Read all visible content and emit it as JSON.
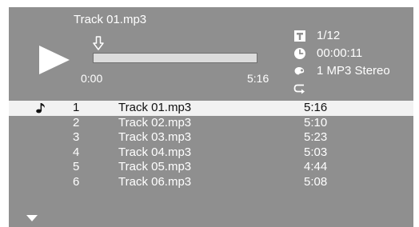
{
  "now_playing": {
    "title": "Track 01.mp3",
    "play_state_icon": "play-icon",
    "elapsed_label": "0:00",
    "total_label": "5:16",
    "progress_fraction": 0.0
  },
  "info": {
    "track_counter": "1/12",
    "time": "00:00:11",
    "audio": "1  MP3 Stereo",
    "icons": [
      "track-counter-icon",
      "clock-icon",
      "audio-stream-icon",
      "repeat-icon"
    ]
  },
  "playlist": {
    "selected_index": 0,
    "items": [
      {
        "num": "1",
        "name": "Track 01.mp3",
        "duration": "5:16"
      },
      {
        "num": "2",
        "name": "Track 02.mp3",
        "duration": "5:10"
      },
      {
        "num": "3",
        "name": "Track 03.mp3",
        "duration": "5:23"
      },
      {
        "num": "4",
        "name": "Track 04.mp3",
        "duration": "5:03"
      },
      {
        "num": "5",
        "name": "Track 05.mp3",
        "duration": "4:44"
      },
      {
        "num": "6",
        "name": "Track 06.mp3",
        "duration": "5:08"
      }
    ],
    "playing_icon": "music-note-icon",
    "scroll_icon": "scroll-down-icon"
  },
  "colors": {
    "screen_background": "#8f8f8f",
    "text": "#ffffff",
    "selected_row_background": "#f2f2f2",
    "selected_row_text": "#111111",
    "progress_track": "#dcdcdc"
  }
}
